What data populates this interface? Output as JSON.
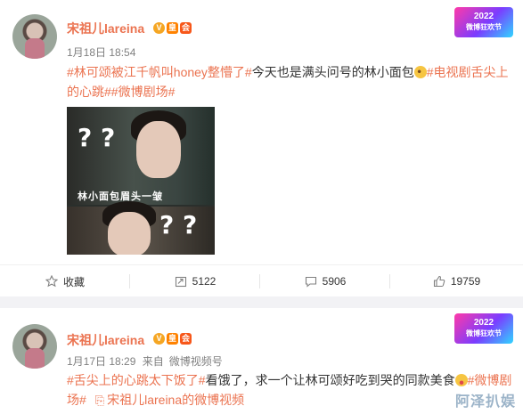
{
  "post1": {
    "author": "宋祖儿lareina",
    "badges": [
      "V",
      "皇",
      "会"
    ],
    "date": "1月18日 18:54",
    "logo_year": "2022",
    "logo_text": "微博狂欢节",
    "text_segments": [
      {
        "t": "#林可颂被江千帆叫honey整懵了#",
        "tag": true
      },
      {
        "t": "今天也是满头问号的林小面包",
        "tag": false
      },
      {
        "emoji": "thinking"
      },
      {
        "t": "#电视剧舌尖上的心跳##微博剧场#",
        "tag": true
      }
    ],
    "media": {
      "caption": "林小面包眉头一皱",
      "qmarks_top": "? ?",
      "qmarks_bottom": "? ?"
    },
    "actions": {
      "favorite_label": "收藏",
      "repost_count": "5122",
      "comment_count": "5906",
      "like_count": "19759"
    }
  },
  "post2": {
    "author": "宋祖儿lareina",
    "badges": [
      "V",
      "皇",
      "会"
    ],
    "date": "1月17日 18:29",
    "source_prefix": "来自",
    "source_name": "微博视频号",
    "logo_year": "2022",
    "logo_text": "微博狂欢节",
    "text_segments": [
      {
        "t": "#舌尖上的心跳太下饭了#",
        "tag": true
      },
      {
        "t": "看饿了，求一个让林可颂好吃到哭的同款美食",
        "tag": false
      },
      {
        "emoji": "yum"
      },
      {
        "t": "#微博剧场#",
        "tag": true
      }
    ],
    "video_link": "宋祖儿lareina的微博视频"
  },
  "watermark": "阿泽扒娱"
}
